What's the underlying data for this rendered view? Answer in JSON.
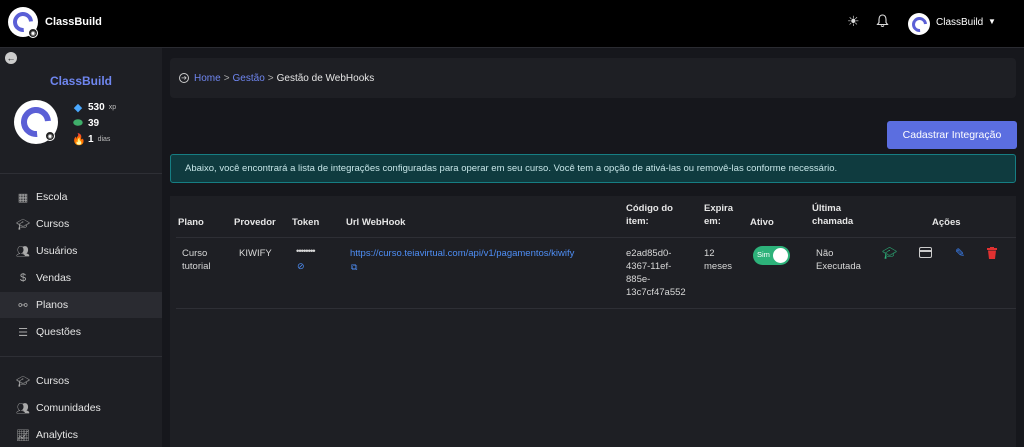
{
  "topbar": {
    "app_title": "ClassBuild",
    "user_name": "ClassBuild",
    "icons": [
      "camera-icon",
      "sun-icon",
      "bell-icon",
      "caret-down-icon"
    ]
  },
  "sidebar": {
    "brand": "ClassBuild",
    "stats": [
      {
        "icon": "diamond-icon",
        "value": "530",
        "unit": "xp"
      },
      {
        "icon": "coins-icon",
        "value": "39",
        "unit": ""
      },
      {
        "icon": "flame-icon",
        "value": "1",
        "unit": "dias"
      }
    ],
    "items": [
      {
        "label": "Escola",
        "icon": "building-icon"
      },
      {
        "label": "Cursos",
        "icon": "graduation-cap-icon"
      },
      {
        "label": "Usuários",
        "icon": "users-icon"
      },
      {
        "label": "Vendas",
        "icon": "dollar-icon"
      },
      {
        "label": "Planos",
        "icon": "webhook-icon"
      },
      {
        "label": "Questões",
        "icon": "database-icon"
      },
      {
        "label": "Cursos",
        "icon": "graduation-cap-icon"
      },
      {
        "label": "Comunidades",
        "icon": "group-icon"
      },
      {
        "label": "Analytics",
        "icon": "chart-line-icon"
      }
    ]
  },
  "breadcrumb": {
    "items": [
      "Home",
      "Gestão"
    ],
    "separator": ">",
    "current": "Gestão de WebHooks"
  },
  "actions": {
    "new_integration_label": "Cadastrar Integração"
  },
  "alert": {
    "text": "Abaixo, você encontrará a lista de integrações configuradas para operar em seu curso. Você tem a opção de ativá-las ou removê-las conforme necessário."
  },
  "table": {
    "headers": {
      "plano": "Plano",
      "provedor": "Provedor",
      "token": "Token",
      "url": "Url WebHook",
      "codigo_1": "Código do",
      "codigo_2": "item:",
      "expira_1": "Expira",
      "expira_2": "em:",
      "ativo": "Ativo",
      "ultima_1": "Última",
      "ultima_2": "chamada",
      "acoes": "Ações"
    },
    "rows": [
      {
        "plano_1": "Curso",
        "plano_2": "tutorial",
        "provedor": "KIWIFY",
        "token": "••••••••",
        "url": "https://curso.teiavirtual.com/api/v1/pagamentos/kiwify",
        "codigo_1": "e2ad85d0-",
        "codigo_2": "4367-11ef-",
        "codigo_3": "885e-",
        "codigo_4": "13c7cf47a552",
        "expira_1": "12",
        "expira_2": "meses",
        "ativo_label": "Sim",
        "ativo": true,
        "ultima_1": "Não",
        "ultima_2": "Executada"
      }
    ]
  },
  "colors": {
    "accent": "#5b6ee0",
    "link": "#4e8ef5",
    "toggle_on": "#2db27a",
    "delete": "#e03131",
    "edit": "#3b82f6"
  }
}
